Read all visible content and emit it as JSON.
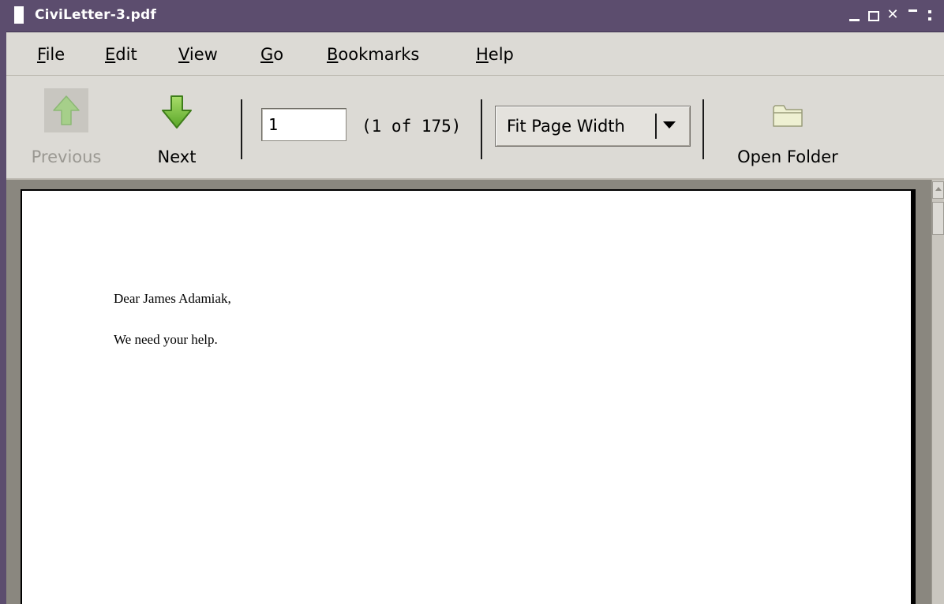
{
  "window": {
    "title": "CiviLetter-3.pdf",
    "controls": {
      "minimize_icon": "minimize-icon",
      "maximize_icon": "maximize-icon",
      "close_icon": "close-icon",
      "close_glyph": "✕",
      "shade_icon": "shade-icon",
      "menu_icon": "window-menu-icon"
    }
  },
  "menubar": {
    "items": [
      {
        "label": "File",
        "mnemonic": "F"
      },
      {
        "label": "Edit",
        "mnemonic": "E"
      },
      {
        "label": "View",
        "mnemonic": "V"
      },
      {
        "label": "Go",
        "mnemonic": "G"
      },
      {
        "label": "Bookmarks",
        "mnemonic": "B"
      },
      {
        "label": "Help",
        "mnemonic": "H"
      }
    ]
  },
  "toolbar": {
    "previous": {
      "label": "Previous",
      "icon": "arrow-up-icon",
      "enabled": false
    },
    "next": {
      "label": "Next",
      "icon": "arrow-down-icon",
      "enabled": true
    },
    "page_input_value": "1",
    "page_count_text": "(1 of 175)",
    "zoom": {
      "selected": "Fit Page Width",
      "icon": "chevron-down-icon"
    },
    "open_folder": {
      "label": "Open Folder",
      "icon": "folder-icon"
    }
  },
  "document": {
    "lines": [
      "Dear James Adamiak,",
      "We need your help."
    ]
  },
  "colors": {
    "titlebar": "#5c4d6e",
    "chrome": "#dcdad5",
    "arrow_green": "#7ac142",
    "folder_fill": "#e7ebc7"
  }
}
